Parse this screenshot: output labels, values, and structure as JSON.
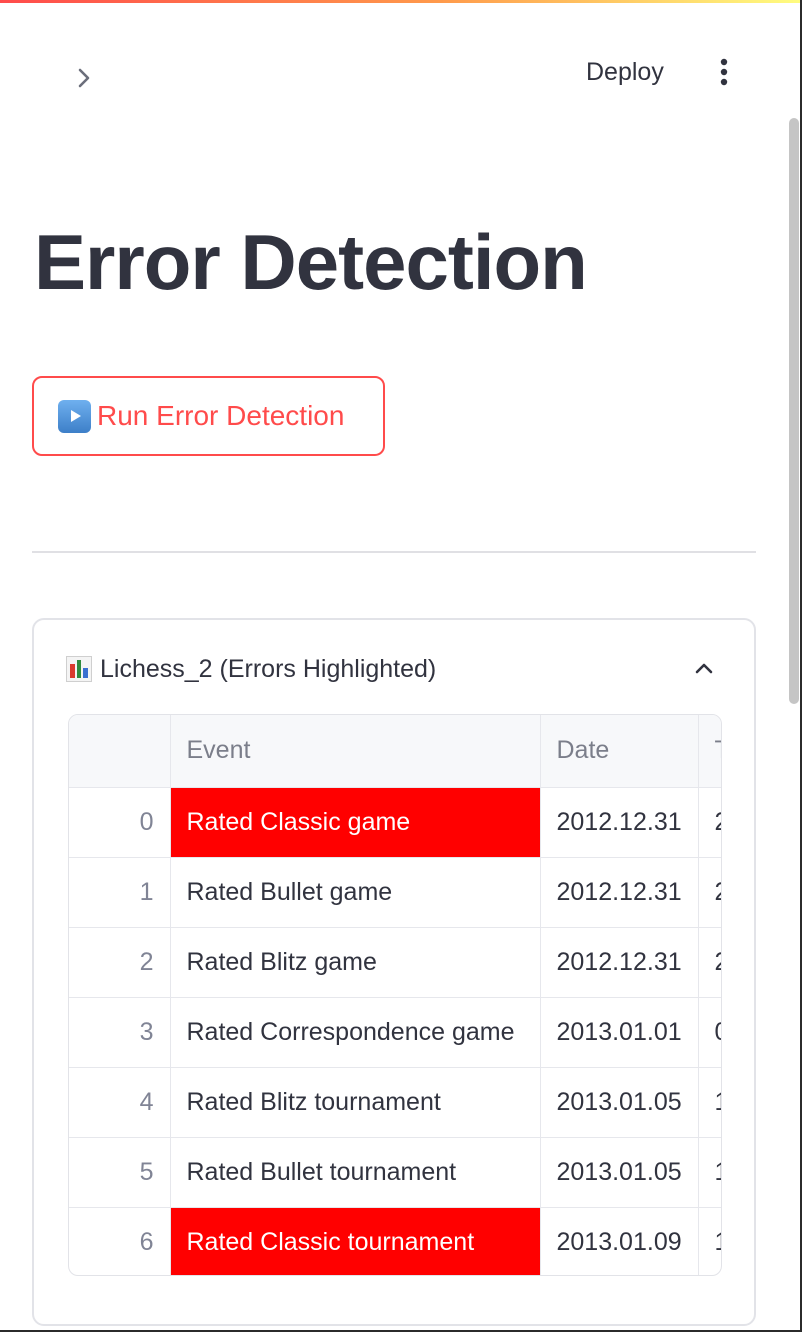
{
  "header": {
    "deploy_label": "Deploy",
    "expand_icon": "chevron-right-icon",
    "menu_icon": "more-vertical-icon"
  },
  "main": {
    "title": "Error Detection",
    "run_button": {
      "icon": "play-button-icon",
      "label": "Run Error Detection"
    }
  },
  "expander": {
    "icon": "bar-chart-icon",
    "title": "Lichess_2 (Errors Highlighted)",
    "toggle_icon": "chevron-up-icon",
    "table": {
      "columns": [
        "",
        "Event",
        "Date",
        "T"
      ],
      "rows": [
        {
          "index": "0",
          "event": "Rated Classic game",
          "date": "2012.12.31",
          "next": "2",
          "error": true
        },
        {
          "index": "1",
          "event": "Rated Bullet game",
          "date": "2012.12.31",
          "next": "2",
          "error": false
        },
        {
          "index": "2",
          "event": "Rated Blitz game",
          "date": "2012.12.31",
          "next": "2",
          "error": false
        },
        {
          "index": "3",
          "event": "Rated Correspondence game",
          "date": "2013.01.01",
          "next": "0",
          "error": false
        },
        {
          "index": "4",
          "event": "Rated Blitz tournament",
          "date": "2013.01.05",
          "next": "1",
          "error": false
        },
        {
          "index": "5",
          "event": "Rated Bullet tournament",
          "date": "2013.01.05",
          "next": "1",
          "error": false
        },
        {
          "index": "6",
          "event": "Rated Classic tournament",
          "date": "2013.01.09",
          "next": "1",
          "error": true
        }
      ]
    }
  },
  "colors": {
    "accent": "#ff4b4b",
    "error_highlight": "#ff0000",
    "text": "#31333f"
  }
}
